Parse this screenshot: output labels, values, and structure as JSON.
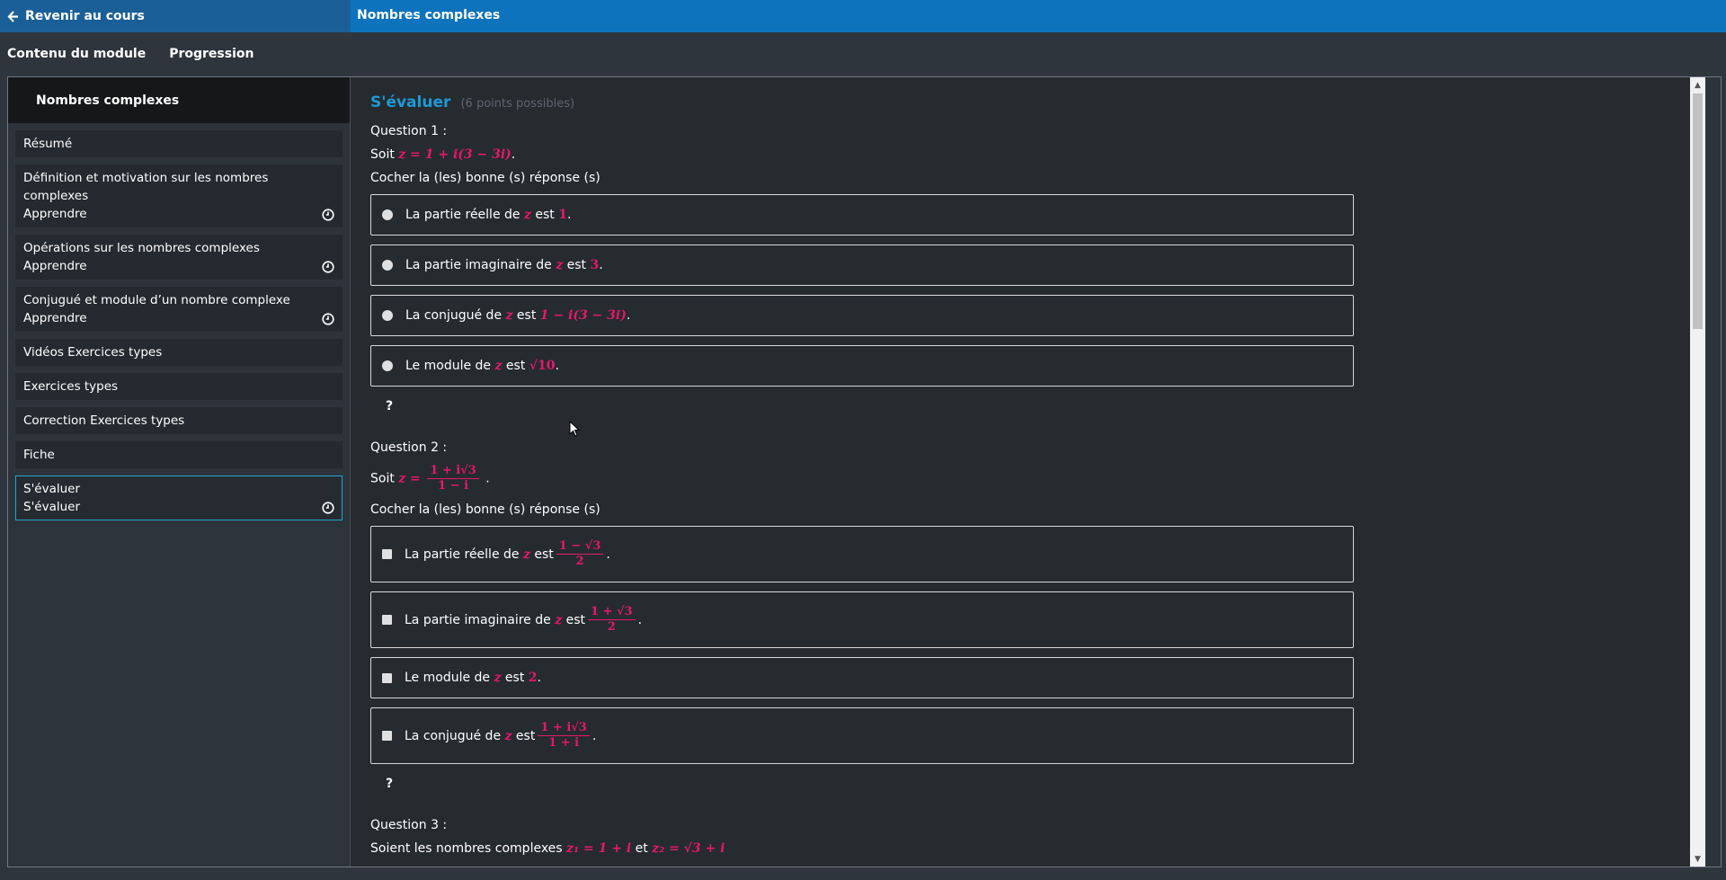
{
  "topbar": {
    "back_label": "Revenir au cours",
    "title": "Nombres complexes"
  },
  "modnav": {
    "content_label": "Contenu du module",
    "progress_label": "Progression"
  },
  "sidebar": {
    "header": "Nombres complexes",
    "items": [
      {
        "line1": "Résumé",
        "line2": "",
        "clock": false,
        "active": false
      },
      {
        "line1": "Définition et motivation sur les nombres complexes",
        "line2": "Apprendre",
        "clock": true,
        "active": false
      },
      {
        "line1": "Opérations sur les nombres complexes",
        "line2": "Apprendre",
        "clock": true,
        "active": false
      },
      {
        "line1": "Conjugué et module d’un nombre complexe",
        "line2": "Apprendre",
        "clock": true,
        "active": false
      },
      {
        "line1": "Vidéos Exercices types",
        "line2": "",
        "clock": false,
        "active": false
      },
      {
        "line1": "Exercices types",
        "line2": "",
        "clock": false,
        "active": false
      },
      {
        "line1": "Correction Exercices types",
        "line2": "",
        "clock": false,
        "active": false
      },
      {
        "line1": "Fiche",
        "line2": "",
        "clock": false,
        "active": false
      },
      {
        "line1": "S'évaluer",
        "line2": "S'évaluer",
        "clock": true,
        "active": true
      }
    ]
  },
  "main": {
    "title": "S'évaluer",
    "points": "(6 points possibles)",
    "instruction": "Cocher la (les) bonne (s) réponse (s)",
    "hint": "?",
    "q1": {
      "label": "Question 1 :",
      "stmt_pre": "Soit",
      "stmt_math": "z = 1 + i(3 − 3i)",
      "opts": [
        {
          "pre": "La partie réelle de",
          "var": "z",
          "mid": "est",
          "val": "1"
        },
        {
          "pre": "La partie imaginaire de",
          "var": "z",
          "mid": "est",
          "val": "3"
        },
        {
          "pre": "La conjugué de",
          "var": "z",
          "mid": "est",
          "val": "1 − i(3 − 3i)"
        },
        {
          "pre": "Le module de",
          "var": "z",
          "mid": "est",
          "val": "√10"
        }
      ]
    },
    "q2": {
      "label": "Question 2 :",
      "stmt_pre": "Soit",
      "stmt_var": "z =",
      "stmt_num": "1 + i√3",
      "stmt_den": "1 − i",
      "opts": [
        {
          "pre": "La partie réelle de",
          "var": "z",
          "mid": "est",
          "num": "1 − √3",
          "den": "2"
        },
        {
          "pre": "La partie imaginaire de",
          "var": "z",
          "mid": "est",
          "num": "1 + √3",
          "den": "2"
        },
        {
          "pre": "Le module de",
          "var": "z",
          "mid": "est",
          "val": "2"
        },
        {
          "pre": "La conjugué de",
          "var": "z",
          "mid": "est",
          "num": "1 + i√3",
          "den": "1 + i"
        }
      ]
    },
    "q3": {
      "label": "Question 3 :",
      "stmt_pre": "Soient les nombres complexes",
      "stmt_math1": "z₁ = 1 + i",
      "stmt_and": "et",
      "stmt_math2": "z₂ = √3 + i"
    }
  }
}
